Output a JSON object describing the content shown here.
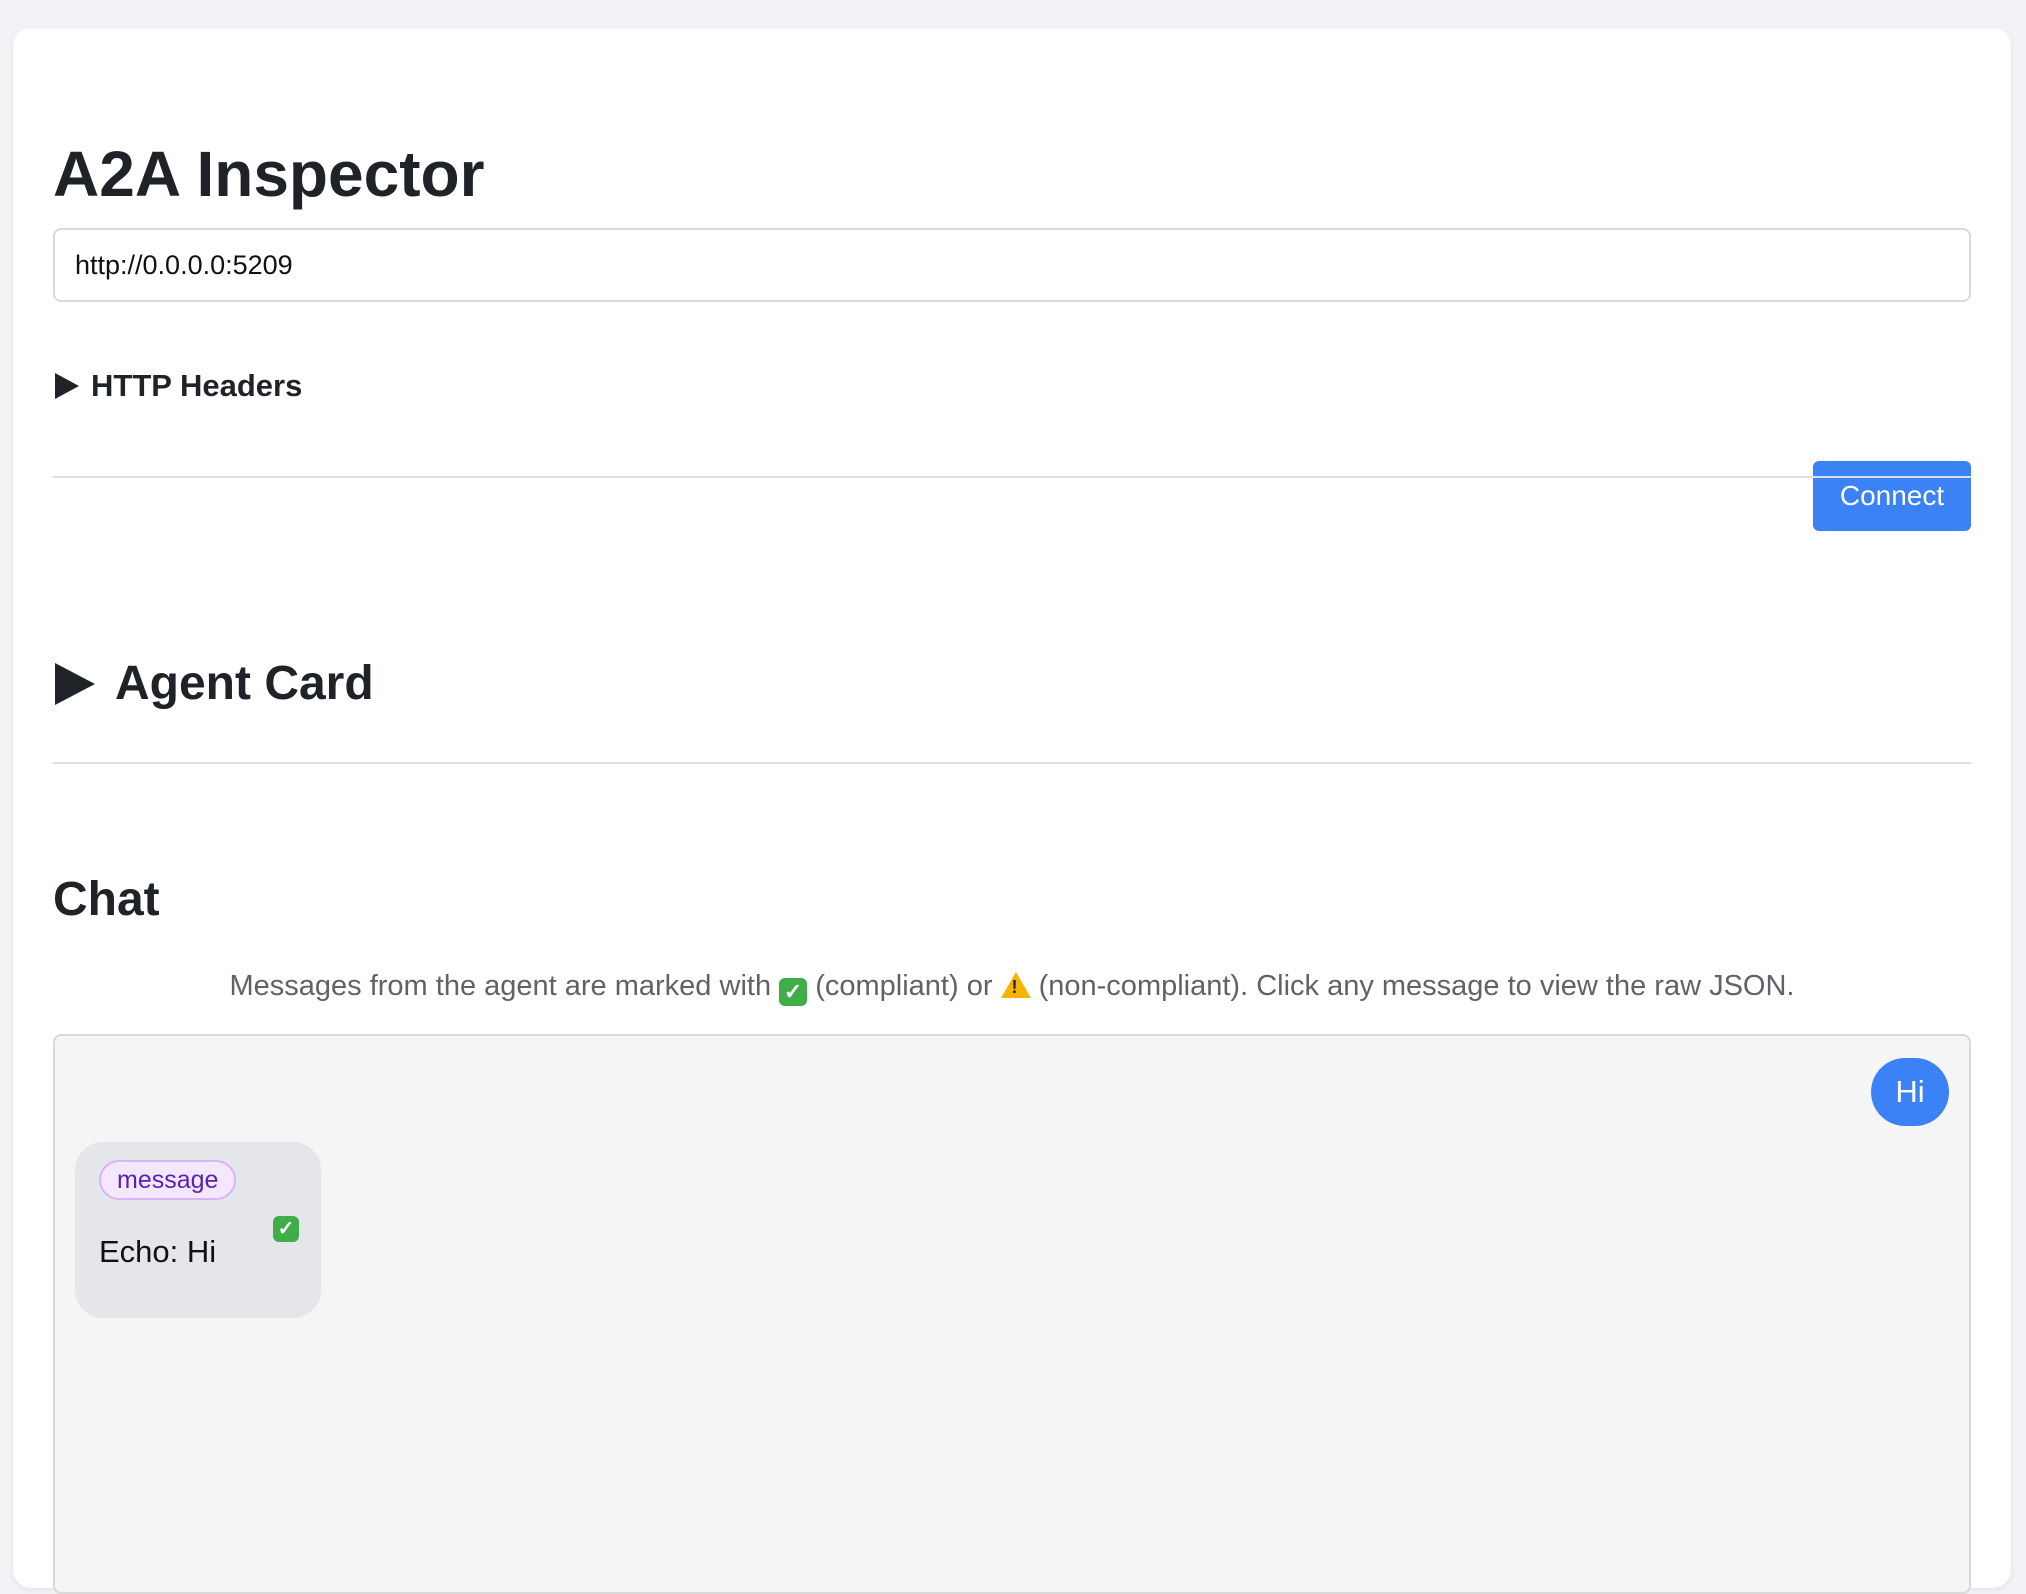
{
  "app": {
    "title": "A2A Inspector"
  },
  "connection": {
    "url_value": "http://0.0.0.0:5209",
    "headers_label": "HTTP Headers",
    "connect_label": "Connect"
  },
  "agent_card": {
    "label": "Agent Card"
  },
  "chat": {
    "title": "Chat",
    "hint_prefix": "Messages from the agent are marked with",
    "hint_compliant": "(compliant) or",
    "hint_noncompliant": "(non-compliant). Click any message to view the raw JSON.",
    "messages": [
      {
        "role": "user",
        "text": "Hi"
      },
      {
        "role": "agent",
        "kind": "message",
        "text": "Echo: Hi",
        "status_icon": "check-icon"
      }
    ]
  },
  "colors": {
    "accent": "#3b82f6",
    "badge_border": "#d8b4fe",
    "badge_text": "#5b21b6",
    "compliant": "#3fae49",
    "noncompliant": "#f4b400"
  }
}
